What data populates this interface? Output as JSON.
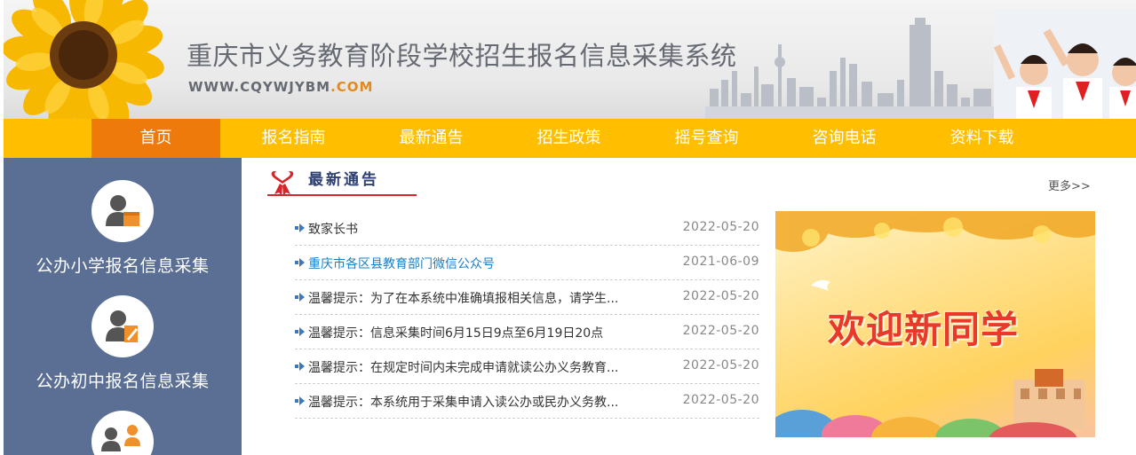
{
  "header": {
    "title": "重庆市义务教育阶段学校招生报名信息采集系统",
    "url_main": "WWW.CQYWJYBM",
    "url_tld": ".COM"
  },
  "nav": {
    "items": [
      {
        "label": "首页",
        "active": true
      },
      {
        "label": "报名指南"
      },
      {
        "label": "最新通告"
      },
      {
        "label": "招生政策"
      },
      {
        "label": "摇号查询"
      },
      {
        "label": "咨询电话"
      },
      {
        "label": "资料下载"
      }
    ]
  },
  "sidebar": {
    "items": [
      {
        "label": "公办小学报名信息采集",
        "icon": "primary-school-user-icon"
      },
      {
        "label": "公办初中报名信息采集",
        "icon": "middle-school-user-icon"
      },
      {
        "label": "",
        "icon": "group-users-icon"
      }
    ]
  },
  "notices": {
    "title": "最新通告",
    "more": "更多>>",
    "items": [
      {
        "title": "致家长书",
        "date": "2022-05-20"
      },
      {
        "title": "重庆市各区县教育部门微信公众号",
        "date": "2021-06-09"
      },
      {
        "title": "温馨提示：为了在本系统中准确填报相关信息，请学生...",
        "date": "2022-05-20"
      },
      {
        "title": "温馨提示：信息采集时间6月15日9点至6月19日20点",
        "date": "2022-05-20"
      },
      {
        "title": "温馨提示：在规定时间内未完成申请就读公办义务教育...",
        "date": "2022-05-20"
      },
      {
        "title": "温馨提示：本系统用于采集申请入读公办或民办义务教...",
        "date": "2022-05-20"
      }
    ]
  },
  "welcome": {
    "text": "欢迎新同学"
  },
  "colors": {
    "nav_bg": "#ffbf00",
    "nav_active": "#ee7a0c",
    "sidebar_bg": "#5b6f95",
    "title_red": "#d7262a",
    "link_blue": "#1b7fc4"
  }
}
